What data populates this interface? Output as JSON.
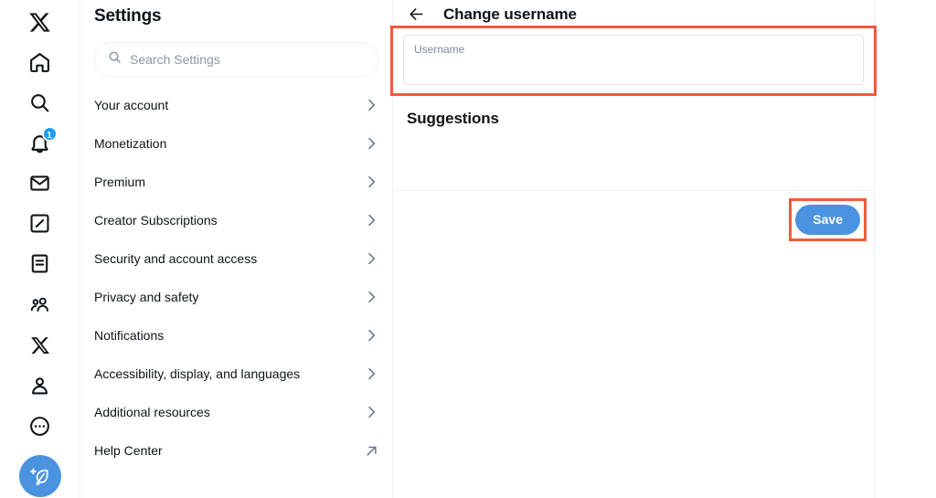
{
  "nav": {
    "items": [
      {
        "name": "x-logo-icon",
        "label": "X"
      },
      {
        "name": "home-icon",
        "label": "Home"
      },
      {
        "name": "search-icon",
        "label": "Explore"
      },
      {
        "name": "bell-icon",
        "label": "Notifications",
        "badge": "1"
      },
      {
        "name": "mail-icon",
        "label": "Messages"
      },
      {
        "name": "grok-icon",
        "label": "Grok"
      },
      {
        "name": "lists-icon",
        "label": "Lists"
      },
      {
        "name": "communities-icon",
        "label": "Communities"
      },
      {
        "name": "x-premium-icon",
        "label": "Premium"
      },
      {
        "name": "profile-icon",
        "label": "Profile"
      },
      {
        "name": "more-icon",
        "label": "More"
      }
    ],
    "compose": {
      "name": "compose-post-button",
      "label": "Post"
    }
  },
  "settings": {
    "title": "Settings",
    "search": {
      "placeholder": "Search Settings",
      "value": ""
    },
    "items": [
      {
        "label": "Your account",
        "trailing": "chevron"
      },
      {
        "label": "Monetization",
        "trailing": "chevron"
      },
      {
        "label": "Premium",
        "trailing": "chevron"
      },
      {
        "label": "Creator Subscriptions",
        "trailing": "chevron"
      },
      {
        "label": "Security and account access",
        "trailing": "chevron"
      },
      {
        "label": "Privacy and safety",
        "trailing": "chevron"
      },
      {
        "label": "Notifications",
        "trailing": "chevron"
      },
      {
        "label": "Accessibility, display, and languages",
        "trailing": "chevron"
      },
      {
        "label": "Additional resources",
        "trailing": "chevron"
      },
      {
        "label": "Help Center",
        "trailing": "external"
      }
    ]
  },
  "main": {
    "back_label": "Back",
    "title": "Change username",
    "username_field": {
      "label": "Username",
      "value": "",
      "placeholder": ""
    },
    "suggestions_title": "Suggestions",
    "save_label": "Save"
  },
  "colors": {
    "accent_blue": "#4a93e0",
    "badge_blue": "#1d9bf0",
    "annotation_red": "#f05a3c",
    "text_primary": "#0f1419",
    "text_secondary": "#5b7083",
    "border": "#eff3f4"
  }
}
